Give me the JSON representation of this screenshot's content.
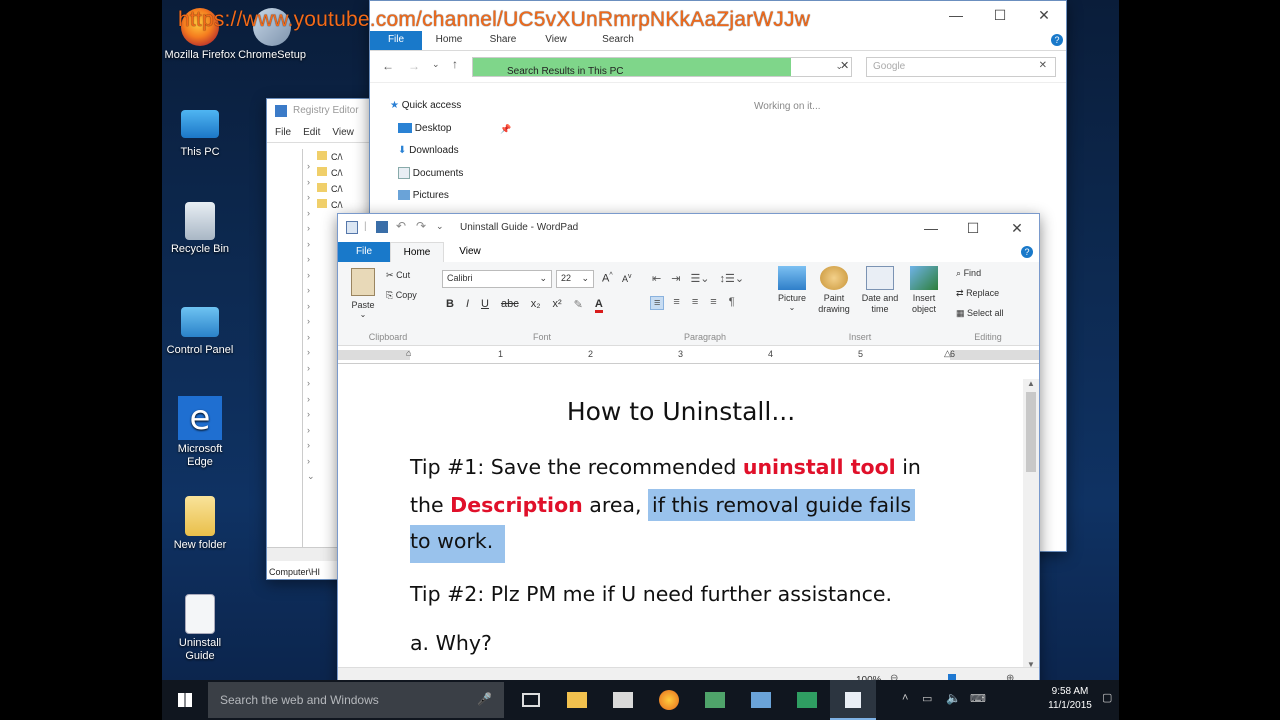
{
  "overlay": {
    "url": "https://www.youtube.com/channel/UC5vXUnRmrpNKkAaZjarWJJw"
  },
  "desktop_icons": [
    {
      "label": "Mozilla Firefox"
    },
    {
      "label": "ChromeSetup"
    },
    {
      "label": "This PC"
    },
    {
      "label": "Recycle Bin"
    },
    {
      "label": "Control Panel"
    },
    {
      "label": "Microsoft Edge"
    },
    {
      "label": "New folder"
    },
    {
      "label": "Uninstall Guide"
    }
  ],
  "explorer": {
    "tabs": [
      "File",
      "Home",
      "Share",
      "View",
      "Search"
    ],
    "address": "Search Results in This PC",
    "search_placeholder": "Google",
    "status": "Working on it...",
    "nav": [
      {
        "label": "Quick access"
      },
      {
        "label": "Desktop"
      },
      {
        "label": "Downloads"
      },
      {
        "label": "Documents"
      },
      {
        "label": "Pictures"
      }
    ]
  },
  "registry": {
    "title": "Registry Editor",
    "menu": [
      "File",
      "Edit",
      "View"
    ],
    "rows": [
      "C/\\",
      "C/\\",
      "C/\\",
      "C/\\"
    ],
    "status": "Computer\\HI"
  },
  "wordpad": {
    "title": "Uninstall Guide - WordPad",
    "tabs": [
      "File",
      "Home",
      "View"
    ],
    "clipboard": {
      "paste": "Paste",
      "cut": "Cut",
      "copy": "Copy",
      "label": "Clipboard"
    },
    "font": {
      "name": "Calibri",
      "size": "22",
      "label": "Font"
    },
    "paragraph_label": "Paragraph",
    "insert": {
      "picture": "Picture",
      "paint": "Paint drawing",
      "datetime": "Date and time",
      "object": "Insert object",
      "label": "Insert"
    },
    "editing": {
      "find": "Find",
      "replace": "Replace",
      "select_all": "Select all",
      "label": "Editing"
    },
    "ruler": [
      "1",
      "2",
      "3",
      "4",
      "5",
      "6"
    ],
    "doc": {
      "heading": "How to Uninstall...",
      "tip1_a": "Tip #1: Save the recommended ",
      "tip1_b": "uninstall tool",
      "tip1_c": " in",
      "tip1_d": "the ",
      "tip1_e": "Description",
      "tip1_f": " area, ",
      "tip1_g": "if this removal guide fails",
      "tip1_h": "to work.",
      "tip2": "Tip #2: Plz PM me if U need further assistance.",
      "a": "a. Why?"
    },
    "zoom": "100%"
  },
  "taskbar": {
    "search_placeholder": "Search the web and Windows",
    "time": "9:58 AM",
    "date": "11/1/2015"
  }
}
